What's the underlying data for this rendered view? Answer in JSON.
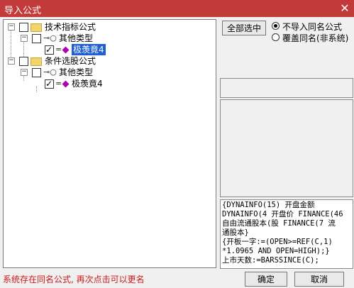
{
  "window": {
    "title": "导入公式"
  },
  "tree": {
    "nodes": [
      {
        "label": "技术指标公式"
      },
      {
        "label": "其他类型"
      },
      {
        "label": "极羡竟4"
      },
      {
        "label": "条件选股公式"
      },
      {
        "label": "其他类型"
      },
      {
        "label": "极羡竟4"
      }
    ]
  },
  "buttons": {
    "select_all": "全部选中",
    "ok": "确定",
    "cancel": "取消"
  },
  "options": {
    "no_import_same": "不导入同名公式",
    "overwrite_same": "覆盖同名(非系统)"
  },
  "code_lines": [
    "{DYNAINFO(15) 开盘金额",
    "DYNAINFO(4  开盘价 FINANCE(46",
    "自由流通股本(股  FINANCE(7 流",
    "通股本}",
    "{开板一字:=(OPEN>=REF(C,1)",
    "*1.0965 AND OPEN=HIGH);}",
    "上市天数:=BARSSINCE(C);"
  ],
  "status": {
    "message": "系统存在同名公式, 再次点击可以更名"
  }
}
